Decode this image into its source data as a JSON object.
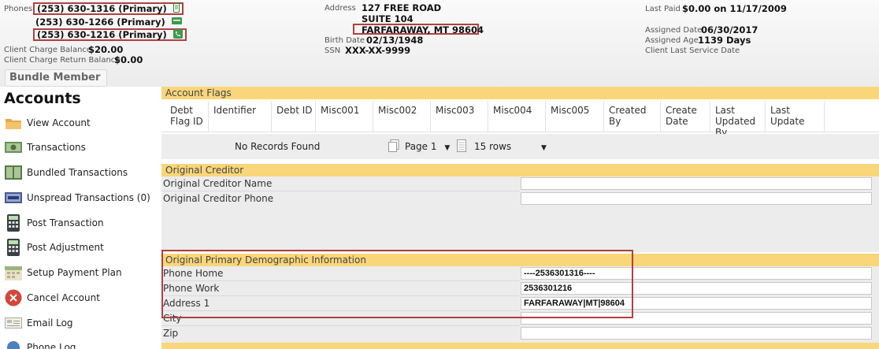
{
  "header": {
    "phones_label": "Phones",
    "phones": [
      {
        "number": "(253) 630-1316 (Primary)",
        "icon": "mobile-phone-icon"
      },
      {
        "number": "(253) 630-1266 (Primary)",
        "icon": "work-phone-icon"
      },
      {
        "number": "(253) 630-1216 (Primary)",
        "icon": "home-phone-icon"
      }
    ],
    "client_charge_balance_label": "Client Charge Balance",
    "client_charge_balance": "$20.00",
    "client_charge_return_balance_label": "Client Charge Return Balance",
    "client_charge_return_balance": "$0.00",
    "bundle_member_label": "Bundle Member",
    "address_label": "Address",
    "address_line1": "127 FREE ROAD",
    "address_line2": "SUITE 104",
    "address_line3": "FARFARAWAY, MT 98604",
    "birth_date_label": "Birth Date",
    "birth_date": "02/13/1948",
    "ssn_label": "SSN",
    "ssn": "XXX-XX-9999",
    "last_paid_label": "Last Paid",
    "last_paid": "$0.00 on 11/17/2009",
    "assigned_date_label": "Assigned Date",
    "assigned_date": "06/30/2017",
    "assigned_age_label": "Assigned Age",
    "assigned_age": "1139 Days",
    "client_last_service_date_label": "Client Last Service Date"
  },
  "sidebar": {
    "title": "Accounts",
    "items": [
      {
        "label": "View Account",
        "icon": "folder-icon"
      },
      {
        "label": "Transactions",
        "icon": "money-icon"
      },
      {
        "label": "Bundled Transactions",
        "icon": "bundled-money-icon"
      },
      {
        "label": "Unspread Transactions (0)",
        "icon": "unspread-icon"
      },
      {
        "label": "Post Transaction",
        "icon": "calculator-icon"
      },
      {
        "label": "Post Adjustment",
        "icon": "calculator-icon"
      },
      {
        "label": "Setup Payment Plan",
        "icon": "calendar-icon"
      },
      {
        "label": "Cancel Account",
        "icon": "cancel-icon"
      },
      {
        "label": "Email Log",
        "icon": "email-icon"
      },
      {
        "label": "Phone Log",
        "icon": "phone-log-icon"
      }
    ]
  },
  "account_flags": {
    "title": "Account Flags",
    "columns": [
      "Debt Flag ID",
      "Identifier",
      "Debt ID",
      "Misc001",
      "Misc002",
      "Misc003",
      "Misc004",
      "Misc005",
      "Created By",
      "Create Date",
      "Last Updated By",
      "Last Update"
    ],
    "no_records": "No Records Found",
    "page_label": "Page 1",
    "rows_label": "15 rows"
  },
  "original_creditor": {
    "title": "Original Creditor",
    "fields": [
      {
        "label": "Original Creditor Name",
        "value": ""
      },
      {
        "label": "Original Creditor Phone",
        "value": ""
      }
    ]
  },
  "original_demographic": {
    "title": "Original Primary Demographic Information",
    "fields": [
      {
        "label": "Phone Home",
        "value": "----2536301316----"
      },
      {
        "label": "Phone Work",
        "value": "2536301216"
      },
      {
        "label": "Address 1",
        "value": "FARFARAWAY|MT|98604"
      },
      {
        "label": "City",
        "value": ""
      },
      {
        "label": "Zip",
        "value": ""
      }
    ]
  },
  "colors": {
    "section_header": "#f8d679",
    "highlight_border": "#b04040"
  }
}
